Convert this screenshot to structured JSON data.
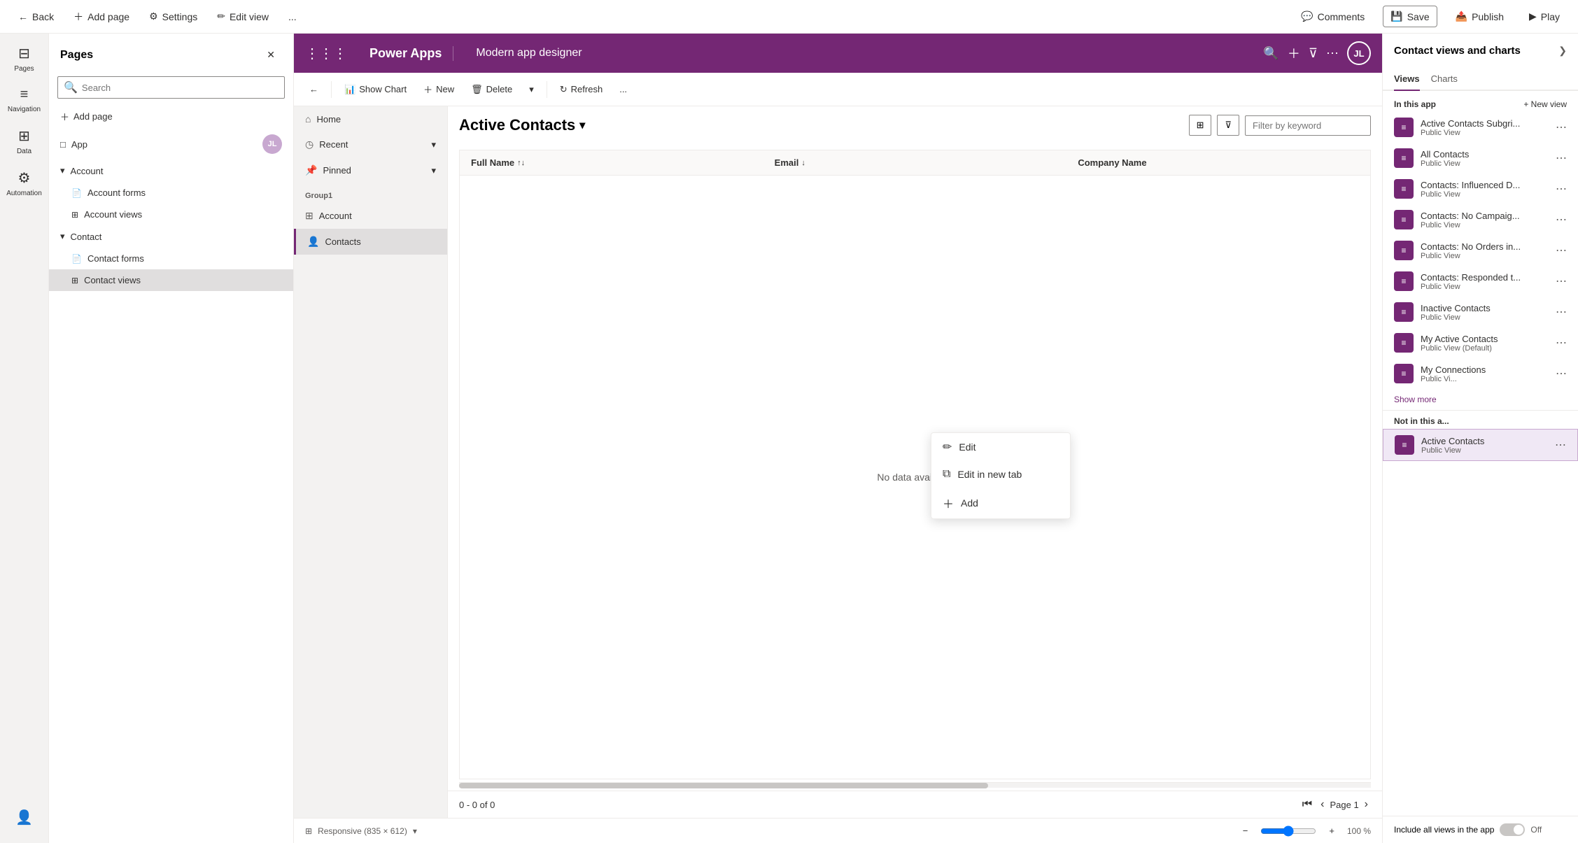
{
  "topbar": {
    "back_label": "Back",
    "add_page_label": "Add page",
    "settings_label": "Settings",
    "edit_view_label": "Edit view",
    "more_label": "...",
    "comments_label": "Comments",
    "save_label": "Save",
    "publish_label": "Publish",
    "play_label": "Play"
  },
  "pages_panel": {
    "title": "Pages",
    "search_placeholder": "Search",
    "add_page_label": "Add page",
    "tree": [
      {
        "id": "app",
        "label": "App",
        "indent": 0,
        "icon": "□",
        "has_badge": true,
        "badge_text": ""
      },
      {
        "id": "account",
        "label": "Account",
        "indent": 0,
        "icon": "▾",
        "is_group": true
      },
      {
        "id": "account-forms",
        "label": "Account forms",
        "indent": 1,
        "icon": "📄"
      },
      {
        "id": "account-views",
        "label": "Account views",
        "indent": 1,
        "icon": "⊞"
      },
      {
        "id": "contact",
        "label": "Contact",
        "indent": 0,
        "icon": "▾",
        "is_group": true
      },
      {
        "id": "contact-forms",
        "label": "Contact forms",
        "indent": 1,
        "icon": "📄"
      },
      {
        "id": "contact-views",
        "label": "Contact views",
        "indent": 1,
        "icon": "⊞",
        "active": true
      }
    ]
  },
  "icon_sidebar": {
    "items": [
      {
        "id": "pages",
        "label": "Pages",
        "icon": "⊟"
      },
      {
        "id": "navigation",
        "label": "Navigation",
        "icon": "≡"
      },
      {
        "id": "data",
        "label": "Data",
        "icon": "⊞"
      },
      {
        "id": "automation",
        "label": "Automation",
        "icon": "⚙"
      }
    ],
    "bottom": {
      "id": "user",
      "label": "",
      "icon": "👤"
    }
  },
  "power_apps_bar": {
    "brand": "Power Apps",
    "title": "Modern app designer",
    "avatar_initials": "JL"
  },
  "canvas_toolbar": {
    "back_label": "←",
    "show_chart_label": "Show Chart",
    "new_label": "New",
    "delete_label": "Delete",
    "more_label": "...",
    "refresh_label": "Refresh",
    "dropdown_label": "▾"
  },
  "canvas": {
    "title": "Active Contacts",
    "title_chevron": "▾",
    "columns": [
      {
        "id": "full-name",
        "label": "Full Name",
        "sort_icon": "↑↓"
      },
      {
        "id": "email",
        "label": "Email",
        "sort_icon": "↓"
      },
      {
        "id": "company-name",
        "label": "Company Name"
      }
    ],
    "no_data_label": "No data available",
    "filter_placeholder": "Filter by keyword",
    "pagination": {
      "range": "0 - 0 of 0",
      "page_label": "Page 1"
    }
  },
  "canvas_sidenav": {
    "items": [
      {
        "id": "home",
        "label": "Home",
        "icon": "⌂"
      },
      {
        "id": "recent",
        "label": "Recent",
        "icon": "◷",
        "has_chevron": true
      },
      {
        "id": "pinned",
        "label": "Pinned",
        "icon": "📌",
        "has_chevron": true
      }
    ],
    "group_label": "Group1",
    "group_items": [
      {
        "id": "account",
        "label": "Account",
        "icon": "⊞"
      },
      {
        "id": "contacts",
        "label": "Contacts",
        "icon": "👤",
        "active": true
      }
    ]
  },
  "right_panel": {
    "title": "Contact views and charts",
    "tabs": [
      {
        "id": "views",
        "label": "Views",
        "active": true
      },
      {
        "id": "charts",
        "label": "Charts"
      }
    ],
    "in_this_app_label": "In this app",
    "new_view_label": "+ New view",
    "views": [
      {
        "id": "active-contacts-subgrid",
        "name": "Active Contacts Subgri...",
        "type": "Public View"
      },
      {
        "id": "all-contacts",
        "name": "All Contacts",
        "type": "Public View"
      },
      {
        "id": "contacts-influenced",
        "name": "Contacts: Influenced D...",
        "type": "Public View"
      },
      {
        "id": "contacts-no-campaign",
        "name": "Contacts: No Campaig...",
        "type": "Public View"
      },
      {
        "id": "contacts-no-orders",
        "name": "Contacts: No Orders in...",
        "type": "Public View"
      },
      {
        "id": "contacts-responded",
        "name": "Contacts: Responded t...",
        "type": "Public View"
      },
      {
        "id": "inactive-contacts",
        "name": "Inactive Contacts",
        "type": "Public View"
      },
      {
        "id": "my-active-contacts",
        "name": "My Active Contacts",
        "type": "Public View (Default)"
      },
      {
        "id": "my-connections",
        "name": "My Connections",
        "type": "Public Vi..."
      }
    ],
    "show_more_label": "Show more",
    "not_in_app_label": "Not in this a...",
    "not_in_app_views": [
      {
        "id": "active-contacts",
        "name": "Active Contacts",
        "type": "Public View",
        "highlighted": true
      }
    ],
    "include_all_label": "Include all views in the app",
    "off_label": "Off"
  },
  "dropdown_menu": {
    "items": [
      {
        "id": "edit",
        "label": "Edit",
        "icon": "✏"
      },
      {
        "id": "edit-new-tab",
        "label": "Edit in new tab",
        "icon": "⧉"
      },
      {
        "id": "add",
        "label": "Add",
        "icon": "+"
      }
    ]
  },
  "status_bar": {
    "responsive_label": "Responsive (835 × 612)",
    "zoom_minus": "−",
    "zoom_value": "100 %",
    "zoom_plus": "+"
  }
}
